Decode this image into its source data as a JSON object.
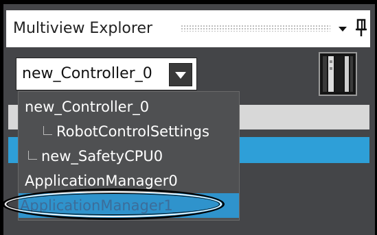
{
  "panel": {
    "title": "Multiview Explorer",
    "dropdown_icon": "triangle-down-icon",
    "pin_icon": "pin-icon"
  },
  "controller_combo": {
    "selected": "new_Controller_0",
    "button_icon": "triangle-down-icon"
  },
  "device_icon": "controller-device-icon",
  "dropdown_list": {
    "items": [
      {
        "label": "new_Controller_0",
        "level": 0
      },
      {
        "label": "RobotControlSettings",
        "level": 1
      },
      {
        "label": "new_SafetyCPU0",
        "level": 0
      },
      {
        "label": "ApplicationManager0",
        "level": 0
      },
      {
        "label": "ApplicationManager1",
        "level": 0
      }
    ],
    "highlighted_index": 4
  },
  "colors": {
    "panel_bg": "#444548",
    "highlight": "#2f93cc",
    "selection_bar": "#2e9fd8"
  }
}
